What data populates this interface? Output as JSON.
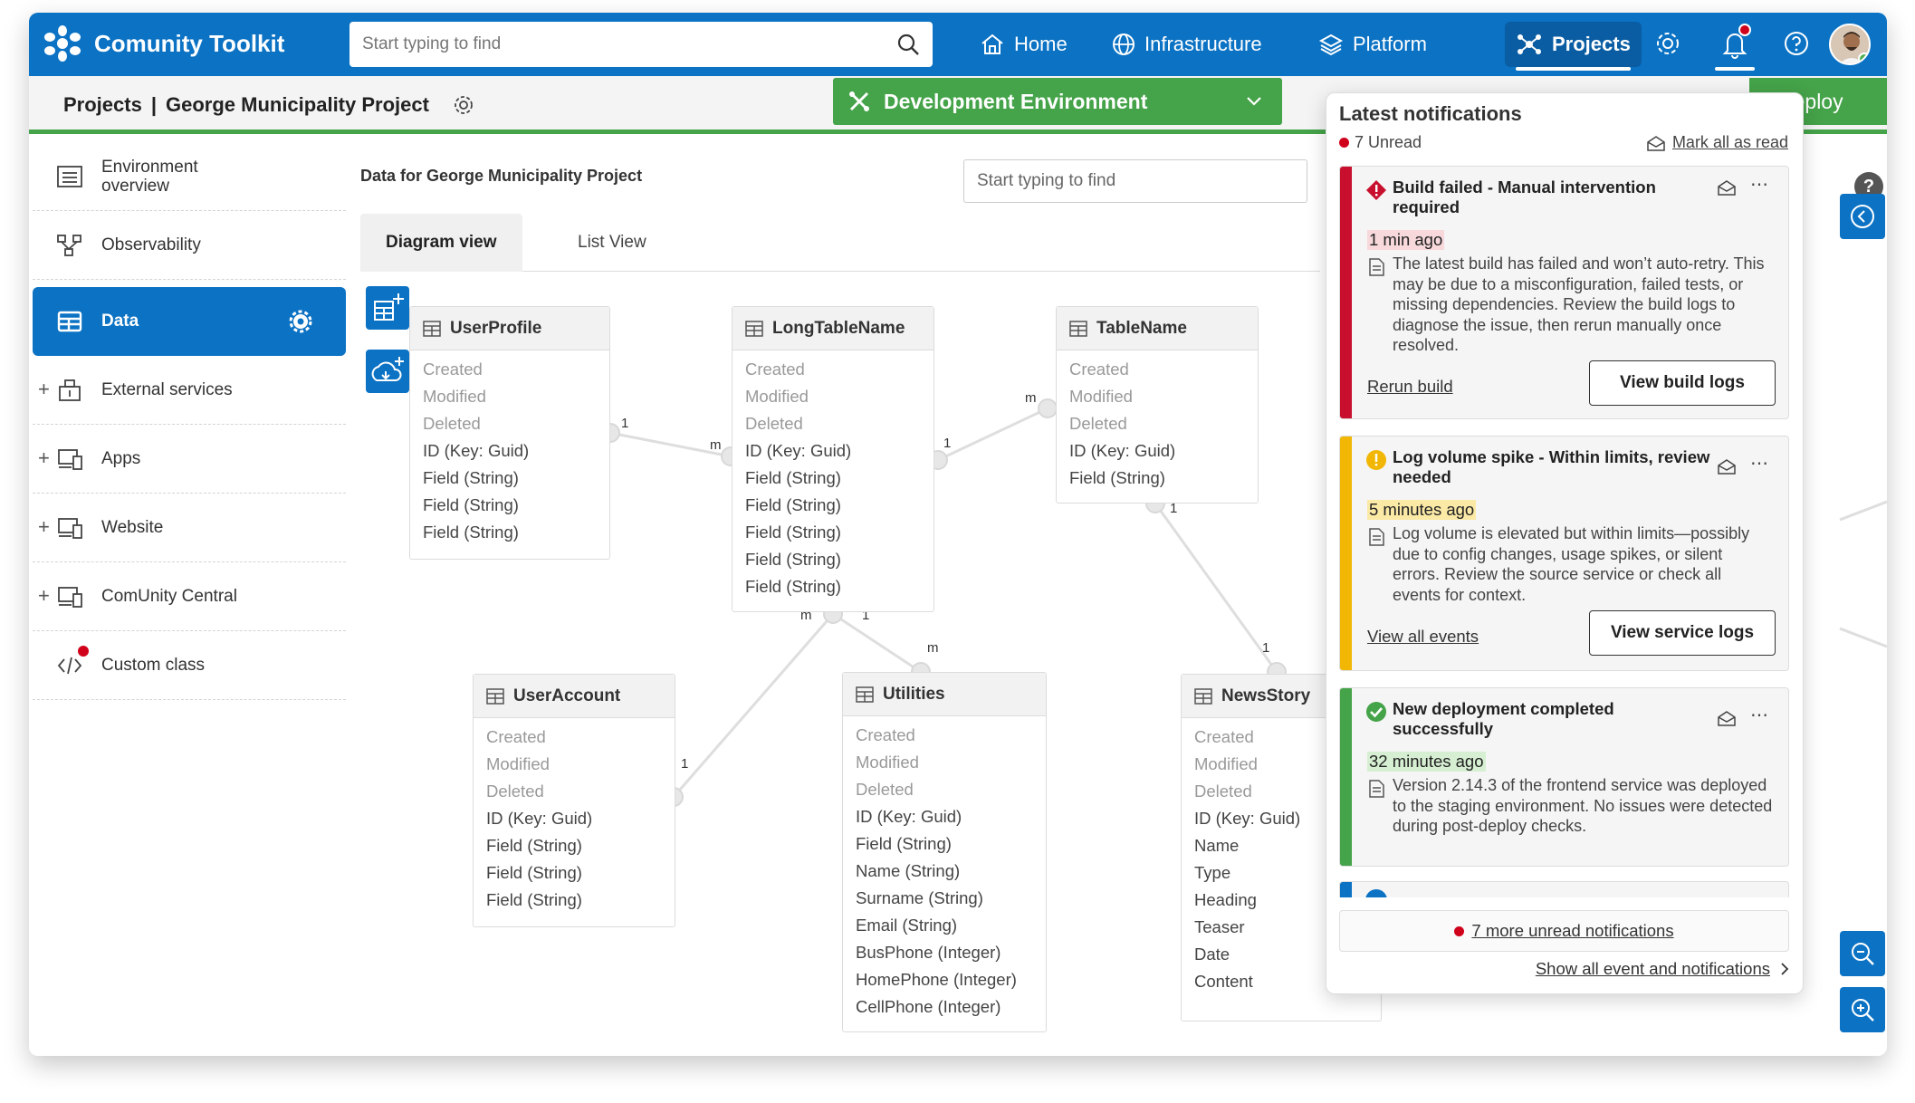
{
  "app": {
    "brand": "Comunity Toolkit"
  },
  "topbar": {
    "search_placeholder": "Start typing to find",
    "nav": [
      {
        "label": "Home",
        "icon": "home-icon"
      },
      {
        "label": "Infrastructure",
        "icon": "globe-icon"
      },
      {
        "label": "Platform",
        "icon": "layers-icon"
      },
      {
        "label": "Projects",
        "icon": "projects-icon",
        "active": true
      }
    ],
    "accent": "#0b72c4"
  },
  "subbar": {
    "crumb_root": "Projects",
    "crumb_separator": "|",
    "crumb_project": "George Municipality Project",
    "environment": "Development Environment",
    "deploy": "Deploy",
    "env_color": "#45a349"
  },
  "sidebar": {
    "items": [
      {
        "label": "Environment overview",
        "icon": "list-icon"
      },
      {
        "label": "Observability",
        "icon": "network-icon"
      },
      {
        "label": "Data",
        "icon": "table-icon",
        "active": true
      },
      {
        "label": "External services",
        "icon": "services-icon",
        "expandable": true
      },
      {
        "label": "Apps",
        "icon": "devices-icon",
        "expandable": true
      },
      {
        "label": "Website",
        "icon": "devices-icon",
        "expandable": true
      },
      {
        "label": "ComUnity Central",
        "icon": "devices-icon",
        "expandable": true
      },
      {
        "label": "Custom class",
        "icon": "code-icon"
      }
    ]
  },
  "main": {
    "title": "Data for George Municipality Project",
    "search_placeholder": "Start typing to find",
    "tabs": [
      "Diagram view",
      "List View"
    ]
  },
  "diagram": {
    "tables": [
      {
        "name": "UserProfile",
        "meta": [
          "Created",
          "Modified",
          "Deleted"
        ],
        "fields": [
          "ID (Key: Guid)",
          "Field (String)",
          "Field (String)",
          "Field (String)"
        ]
      },
      {
        "name": "LongTableName",
        "meta": [
          "Created",
          "Modified",
          "Deleted"
        ],
        "fields": [
          "ID (Key: Guid)",
          "Field (String)",
          "Field (String)",
          "Field (String)",
          "Field (String)",
          "Field (String)"
        ]
      },
      {
        "name": "TableName",
        "meta": [
          "Created",
          "Modified",
          "Deleted"
        ],
        "fields": [
          "ID (Key: Guid)",
          "Field (String)"
        ]
      },
      {
        "name": "UserAccount",
        "meta": [
          "Created",
          "Modified",
          "Deleted"
        ],
        "fields": [
          "ID (Key: Guid)",
          "Field (String)",
          "Field (String)",
          "Field (String)"
        ]
      },
      {
        "name": "Utilities",
        "meta": [
          "Created",
          "Modified",
          "Deleted"
        ],
        "fields": [
          "ID (Key: Guid)",
          "Field (String)",
          "Name (String)",
          "Surname (String)",
          "Email (String)",
          "BusPhone (Integer)",
          "HomePhone (Integer)",
          "CellPhone (Integer)"
        ]
      },
      {
        "name": "NewsStory",
        "meta": [
          "Created",
          "Modified",
          "Deleted"
        ],
        "fields": [
          "ID (Key: Guid)",
          "Name",
          "Type",
          "Heading",
          "Teaser",
          "Date",
          "Content"
        ]
      }
    ],
    "labels": [
      "1",
      "m",
      "1",
      "m",
      "1",
      "m",
      "1",
      "m",
      "1",
      "1"
    ]
  },
  "notifications": {
    "title": "Latest notifications",
    "unread": "7 Unread",
    "mark_all": "Mark all as read",
    "items": [
      {
        "title": "Build failed - Manual intervention required",
        "time": "1 min ago",
        "body": "The latest build has failed and won’t auto-retry. This may be due to a misconfiguration, failed tests, or missing dependencies. Review the build logs to diagnose the issue, then rerun manually once resolved.",
        "link": "Rerun build",
        "button": "View build logs",
        "color": "#c8102e",
        "time_bg": "#f7d9dc"
      },
      {
        "title": "Log volume spike - Within limits, review needed",
        "time": "5 minutes ago",
        "body": "Log volume is elevated but within limits—possibly due to config changes, usage spikes, or silent errors. Review the source service or check all events for context.",
        "link": "View all events",
        "button": "View service logs",
        "color": "#f2b705",
        "time_bg": "#fbe9a6"
      },
      {
        "title": "New deployment completed successfully",
        "time": "32 minutes ago",
        "body": "Version 2.14.3 of the frontend service was deployed to the staging environment. No issues were detected during post-deploy checks.",
        "color": "#45a349",
        "time_bg": "#d6efd2"
      }
    ],
    "more": "7 more unread notifications",
    "show_all": "Show all event and notifications"
  }
}
